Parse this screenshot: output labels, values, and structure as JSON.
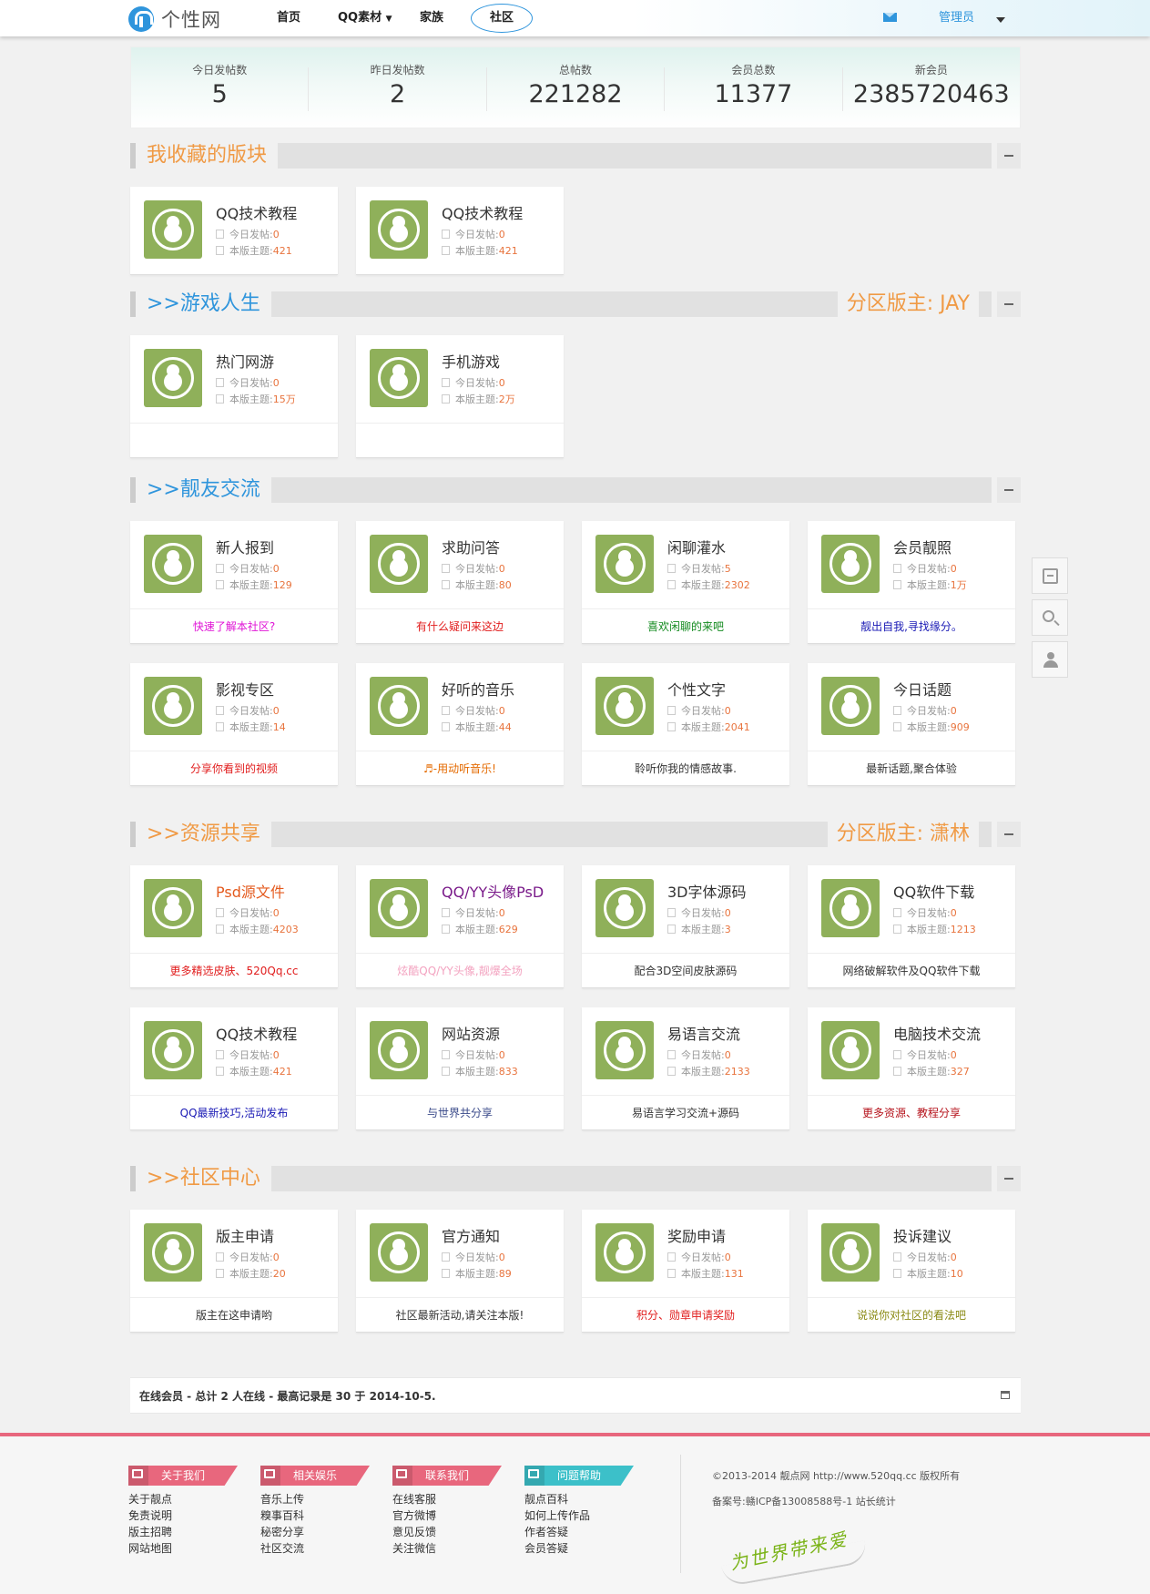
{
  "header": {
    "logo_text": "个性网",
    "nav": [
      "首页",
      "QQ素材",
      "家族",
      "社区"
    ],
    "user": "管理员"
  },
  "stats": [
    {
      "label": "今日发帖数",
      "value": "5"
    },
    {
      "label": "昨日发帖数",
      "value": "2"
    },
    {
      "label": "总帖数",
      "value": "221282"
    },
    {
      "label": "会员总数",
      "value": "11377"
    },
    {
      "label": "新会员",
      "value": "2385720463"
    }
  ],
  "sections": [
    {
      "title": "我收藏的版块",
      "moderator": ""
    },
    {
      "title": ">>游戏人生",
      "moderator": "分区版主: JAY"
    },
    {
      "title": ">>靓友交流",
      "moderator": ""
    },
    {
      "title": ">>资源共享",
      "moderator": "分区版主: 潇林"
    },
    {
      "title": ">>社区中心",
      "moderator": ""
    }
  ],
  "labels": {
    "today": "今日发帖:",
    "topics": "本版主题:"
  },
  "forums": {
    "fav": [
      {
        "name": "QQ技术教程",
        "today": "0",
        "topics": "421"
      },
      {
        "name": "QQ技术教程",
        "today": "0",
        "topics": "421"
      }
    ],
    "game": [
      {
        "name": "热门网游",
        "today": "0",
        "topics": "15万"
      },
      {
        "name": "手机游戏",
        "today": "0",
        "topics": "2万"
      }
    ],
    "friends": [
      {
        "name": "新人报到",
        "today": "0",
        "topics": "129",
        "desc": "快速了解本社区?"
      },
      {
        "name": "求助问答",
        "today": "0",
        "topics": "80",
        "desc": "有什么疑问来这边"
      },
      {
        "name": "闲聊灌水",
        "today": "5",
        "topics": "2302",
        "desc": "喜欢闲聊的来吧"
      },
      {
        "name": "会员靓照",
        "today": "0",
        "topics": "1万",
        "desc": "靓出自我,寻找缘分。"
      },
      {
        "name": "影视专区",
        "today": "0",
        "topics": "14",
        "desc": "分享你看到的视频"
      },
      {
        "name": "好听的音乐",
        "today": "0",
        "topics": "44",
        "desc": "♬-用动听音乐!"
      },
      {
        "name": "个性文字",
        "today": "0",
        "topics": "2041",
        "desc": "聆听你我的情感故事."
      },
      {
        "name": "今日话题",
        "today": "0",
        "topics": "909",
        "desc": "最新话题,聚合体验"
      }
    ],
    "resources": [
      {
        "name": "Psd源文件",
        "today": "0",
        "topics": "4203",
        "desc": "更多精选皮肤、520Qq.cc"
      },
      {
        "name": "QQ/YY头像PsD",
        "today": "0",
        "topics": "629",
        "desc": "炫酷QQ/YY头像,靓爆全场"
      },
      {
        "name": "3D字体源码",
        "today": "0",
        "topics": "3",
        "desc": "配合3D空间皮肤源码"
      },
      {
        "name": "QQ软件下载",
        "today": "0",
        "topics": "1213",
        "desc": "网络破解软件及QQ软件下载"
      },
      {
        "name": "QQ技术教程",
        "today": "0",
        "topics": "421",
        "desc": "QQ最新技巧,活动发布"
      },
      {
        "name": "网站资源",
        "today": "0",
        "topics": "833",
        "desc": "与世界共分享"
      },
      {
        "name": "易语言交流",
        "today": "0",
        "topics": "2133",
        "desc": "易语言学习交流+源码"
      },
      {
        "name": "电脑技术交流",
        "today": "0",
        "topics": "327",
        "desc": "更多资源、教程分享"
      }
    ],
    "center": [
      {
        "name": "版主申请",
        "today": "0",
        "topics": "20",
        "desc": "版主在这申请哟"
      },
      {
        "name": "官方通知",
        "today": "0",
        "topics": "89",
        "desc": "社区最新活动,请关注本版!"
      },
      {
        "name": "奖励申请",
        "today": "0",
        "topics": "131",
        "desc": "积分、勋章申请奖励"
      },
      {
        "name": "投诉建议",
        "today": "0",
        "topics": "10",
        "desc": "说说你对社区的看法吧"
      }
    ]
  },
  "online": "在线会员 - 总计 2 人在线 - 最高记录是 30 于 2014-10-5.",
  "footer": {
    "columns": [
      {
        "title": "关于我们",
        "color": "#e8677d",
        "links": [
          "关于靓点",
          "免责说明",
          "版主招聘",
          "网站地图"
        ]
      },
      {
        "title": "相关娱乐",
        "color": "#e8677d",
        "links": [
          "音乐上传",
          "糗事百科",
          "秘密分享",
          "社区交流"
        ]
      },
      {
        "title": "联系我们",
        "color": "#e8677d",
        "links": [
          "在线客服",
          "官方微博",
          "意见反馈",
          "关注微信"
        ]
      },
      {
        "title": "问题帮助",
        "color": "#3cc0c9",
        "links": [
          "靓点百科",
          "如何上传作品",
          "作者答疑",
          "会员答疑"
        ]
      }
    ],
    "copyright": "©2013-2014 靓点网 http://www.520qq.cc 版权所有",
    "icp": "备案号:赣ICP备13008588号-1 站长统计",
    "slogan": "为世界带来爱"
  },
  "colors": {
    "accent": "#2f95dc",
    "section_orange": "#f09a45",
    "avatar": "#8fb05a",
    "footer_line": "#e8677d"
  }
}
